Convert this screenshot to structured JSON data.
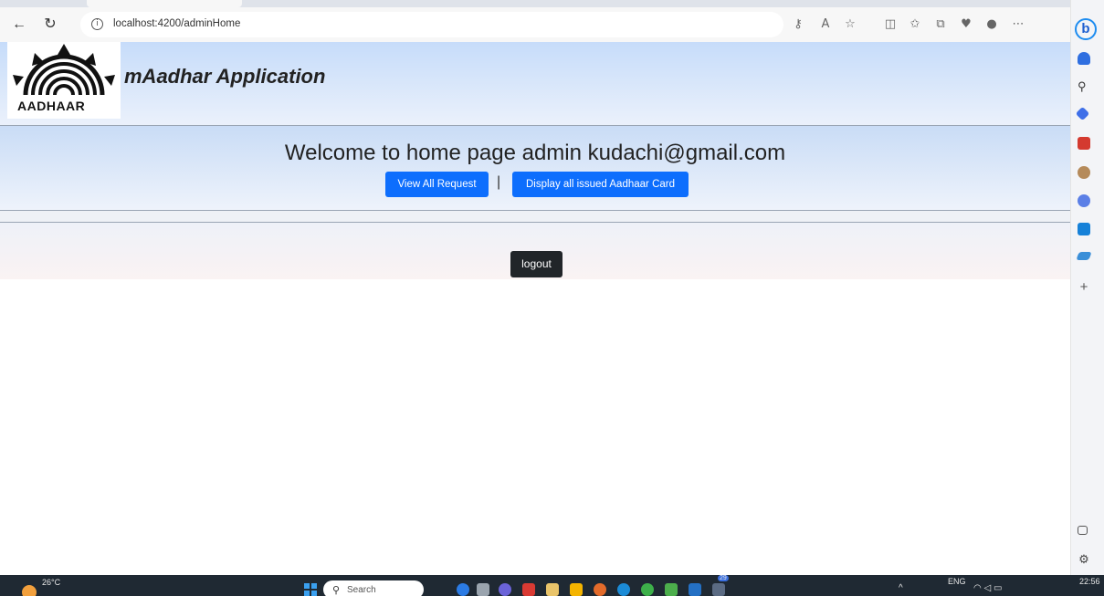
{
  "browser": {
    "url": "localhost:4200/adminHome",
    "sidebar_icons": [
      "bing-chat-icon",
      "bell-icon",
      "search-icon",
      "tag-icon",
      "toolbox-icon",
      "people-icon",
      "office-icon",
      "outlook-icon",
      "send-icon",
      "add-icon",
      "split-screen-icon",
      "settings-icon"
    ]
  },
  "header": {
    "logo_text": "AADHAAR",
    "app_title": "mAadhar Application"
  },
  "main": {
    "welcome": "Welcome to home page admin kudachi@gmail.com",
    "view_requests_label": "View All Request",
    "separator": "|",
    "display_cards_label": "Display all issued Aadhaar Card",
    "logout_label": "logout"
  },
  "taskbar": {
    "temperature": "26°C",
    "search_placeholder": "Search",
    "language": "ENG",
    "time": "22:56",
    "notification_count": "29"
  },
  "colors": {
    "primary_button": "#0d6efd",
    "dark_button": "#212529",
    "header_gradient_top": "#c6dcfa"
  }
}
